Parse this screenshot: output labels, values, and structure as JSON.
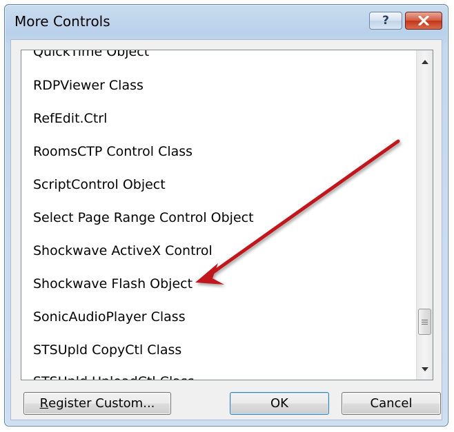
{
  "window": {
    "title": "More Controls",
    "help_label": "?"
  },
  "list": {
    "items": [
      "QuickTime Object",
      "RDPViewer Class",
      "RefEdit.Ctrl",
      "RoomsCTP Control Class",
      "ScriptControl Object",
      "Select Page Range Control Object",
      "Shockwave ActiveX Control",
      "Shockwave Flash Object",
      "SonicAudioPlayer Class",
      "STSUpld CopyCtl Class",
      "STSUpld UploadCtl Class"
    ]
  },
  "buttons": {
    "register_underline": "R",
    "register_rest": "egister Custom...",
    "ok": "OK",
    "cancel": "Cancel"
  },
  "colors": {
    "annotation_arrow": "#c0161c"
  }
}
